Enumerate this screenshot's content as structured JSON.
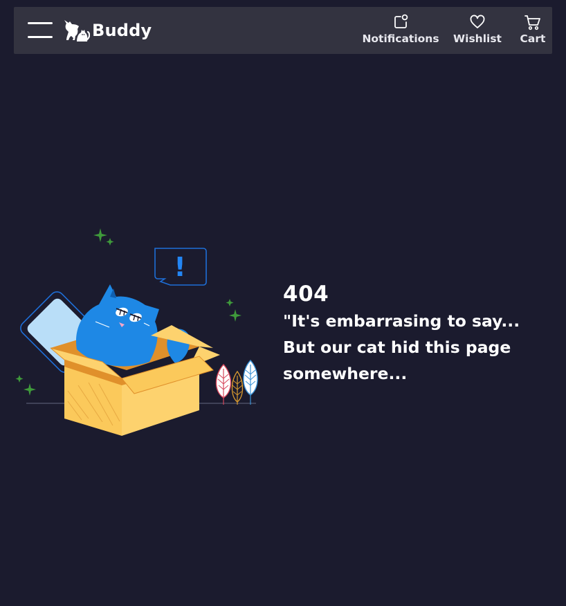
{
  "header": {
    "brand_name": "Buddy",
    "menu_icon": "hamburger-menu-icon",
    "logo_icon": "cat-dog-logo-icon",
    "nav": {
      "notifications": {
        "label": "Notifications",
        "icon": "notification-icon"
      },
      "wishlist": {
        "label": "Wishlist",
        "icon": "heart-icon"
      },
      "cart": {
        "label": "Cart",
        "icon": "cart-icon"
      }
    }
  },
  "error": {
    "code": "404",
    "line1": "\"It's embarrasing to say...",
    "line2": "But our cat hid this page",
    "line3": "somewhere...",
    "illustration_icon": "cat-in-box-illustration",
    "speech_mark": "!"
  },
  "colors": {
    "background": "#1b1b2e",
    "navbar": "#333340",
    "text": "#ffffff",
    "cat": "#1e88e5",
    "box": "#fbc95b",
    "sparkle": "#3f9a3b",
    "speech_bubble": "#0d6efd"
  }
}
